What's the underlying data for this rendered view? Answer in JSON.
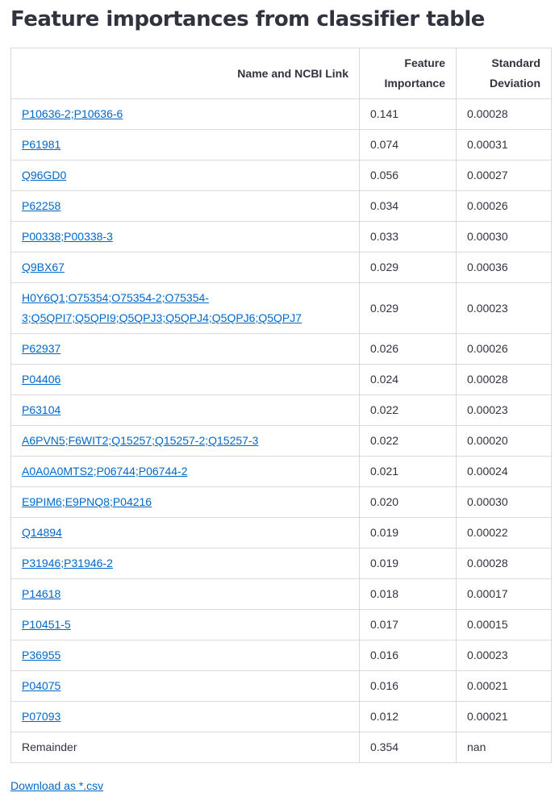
{
  "title": "Feature importances from classifier table",
  "table": {
    "headers": {
      "name": "Name and NCBI Link",
      "importance_line1": "Feature",
      "importance_line2": "Importance",
      "std_line1": "Standard",
      "std_line2": "Deviation"
    },
    "rows": [
      {
        "name": "P10636-2;P10636-6",
        "link": true,
        "importance": "0.141",
        "std": "0.00028"
      },
      {
        "name": "P61981",
        "link": true,
        "importance": "0.074",
        "std": "0.00031"
      },
      {
        "name": "Q96GD0",
        "link": true,
        "importance": "0.056",
        "std": "0.00027"
      },
      {
        "name": "P62258",
        "link": true,
        "importance": "0.034",
        "std": "0.00026"
      },
      {
        "name": "P00338;P00338-3",
        "link": true,
        "importance": "0.033",
        "std": "0.00030"
      },
      {
        "name": "Q9BX67",
        "link": true,
        "importance": "0.029",
        "std": "0.00036"
      },
      {
        "name": "H0Y6Q1;O75354;O75354-2;O75354-3;Q5QPI7;Q5QPI9;Q5QPJ3;Q5QPJ4;Q5QPJ6;Q5QPJ7",
        "link": true,
        "tall": true,
        "importance": "0.029",
        "std": "0.00023"
      },
      {
        "name": "P62937",
        "link": true,
        "importance": "0.026",
        "std": "0.00026"
      },
      {
        "name": "P04406",
        "link": true,
        "importance": "0.024",
        "std": "0.00028"
      },
      {
        "name": "P63104",
        "link": true,
        "importance": "0.022",
        "std": "0.00023"
      },
      {
        "name": "A6PVN5;F6WIT2;Q15257;Q15257-2;Q15257-3",
        "link": true,
        "importance": "0.022",
        "std": "0.00020"
      },
      {
        "name": "A0A0A0MTS2;P06744;P06744-2",
        "link": true,
        "importance": "0.021",
        "std": "0.00024"
      },
      {
        "name": "E9PIM6;E9PNQ8;P04216",
        "link": true,
        "importance": "0.020",
        "std": "0.00030"
      },
      {
        "name": "Q14894",
        "link": true,
        "importance": "0.019",
        "std": "0.00022"
      },
      {
        "name": "P31946;P31946-2",
        "link": true,
        "importance": "0.019",
        "std": "0.00028"
      },
      {
        "name": "P14618",
        "link": true,
        "importance": "0.018",
        "std": "0.00017"
      },
      {
        "name": "P10451-5",
        "link": true,
        "importance": "0.017",
        "std": "0.00015"
      },
      {
        "name": "P36955",
        "link": true,
        "importance": "0.016",
        "std": "0.00023"
      },
      {
        "name": "P04075",
        "link": true,
        "importance": "0.016",
        "std": "0.00021"
      },
      {
        "name": "P07093",
        "link": true,
        "importance": "0.012",
        "std": "0.00021"
      },
      {
        "name": "Remainder",
        "link": false,
        "importance": "0.354",
        "std": "nan"
      }
    ]
  },
  "download_link": "Download as *.csv",
  "colors": {
    "link": "#0068c9",
    "text": "#31333f",
    "border": "#d9d9dd"
  }
}
